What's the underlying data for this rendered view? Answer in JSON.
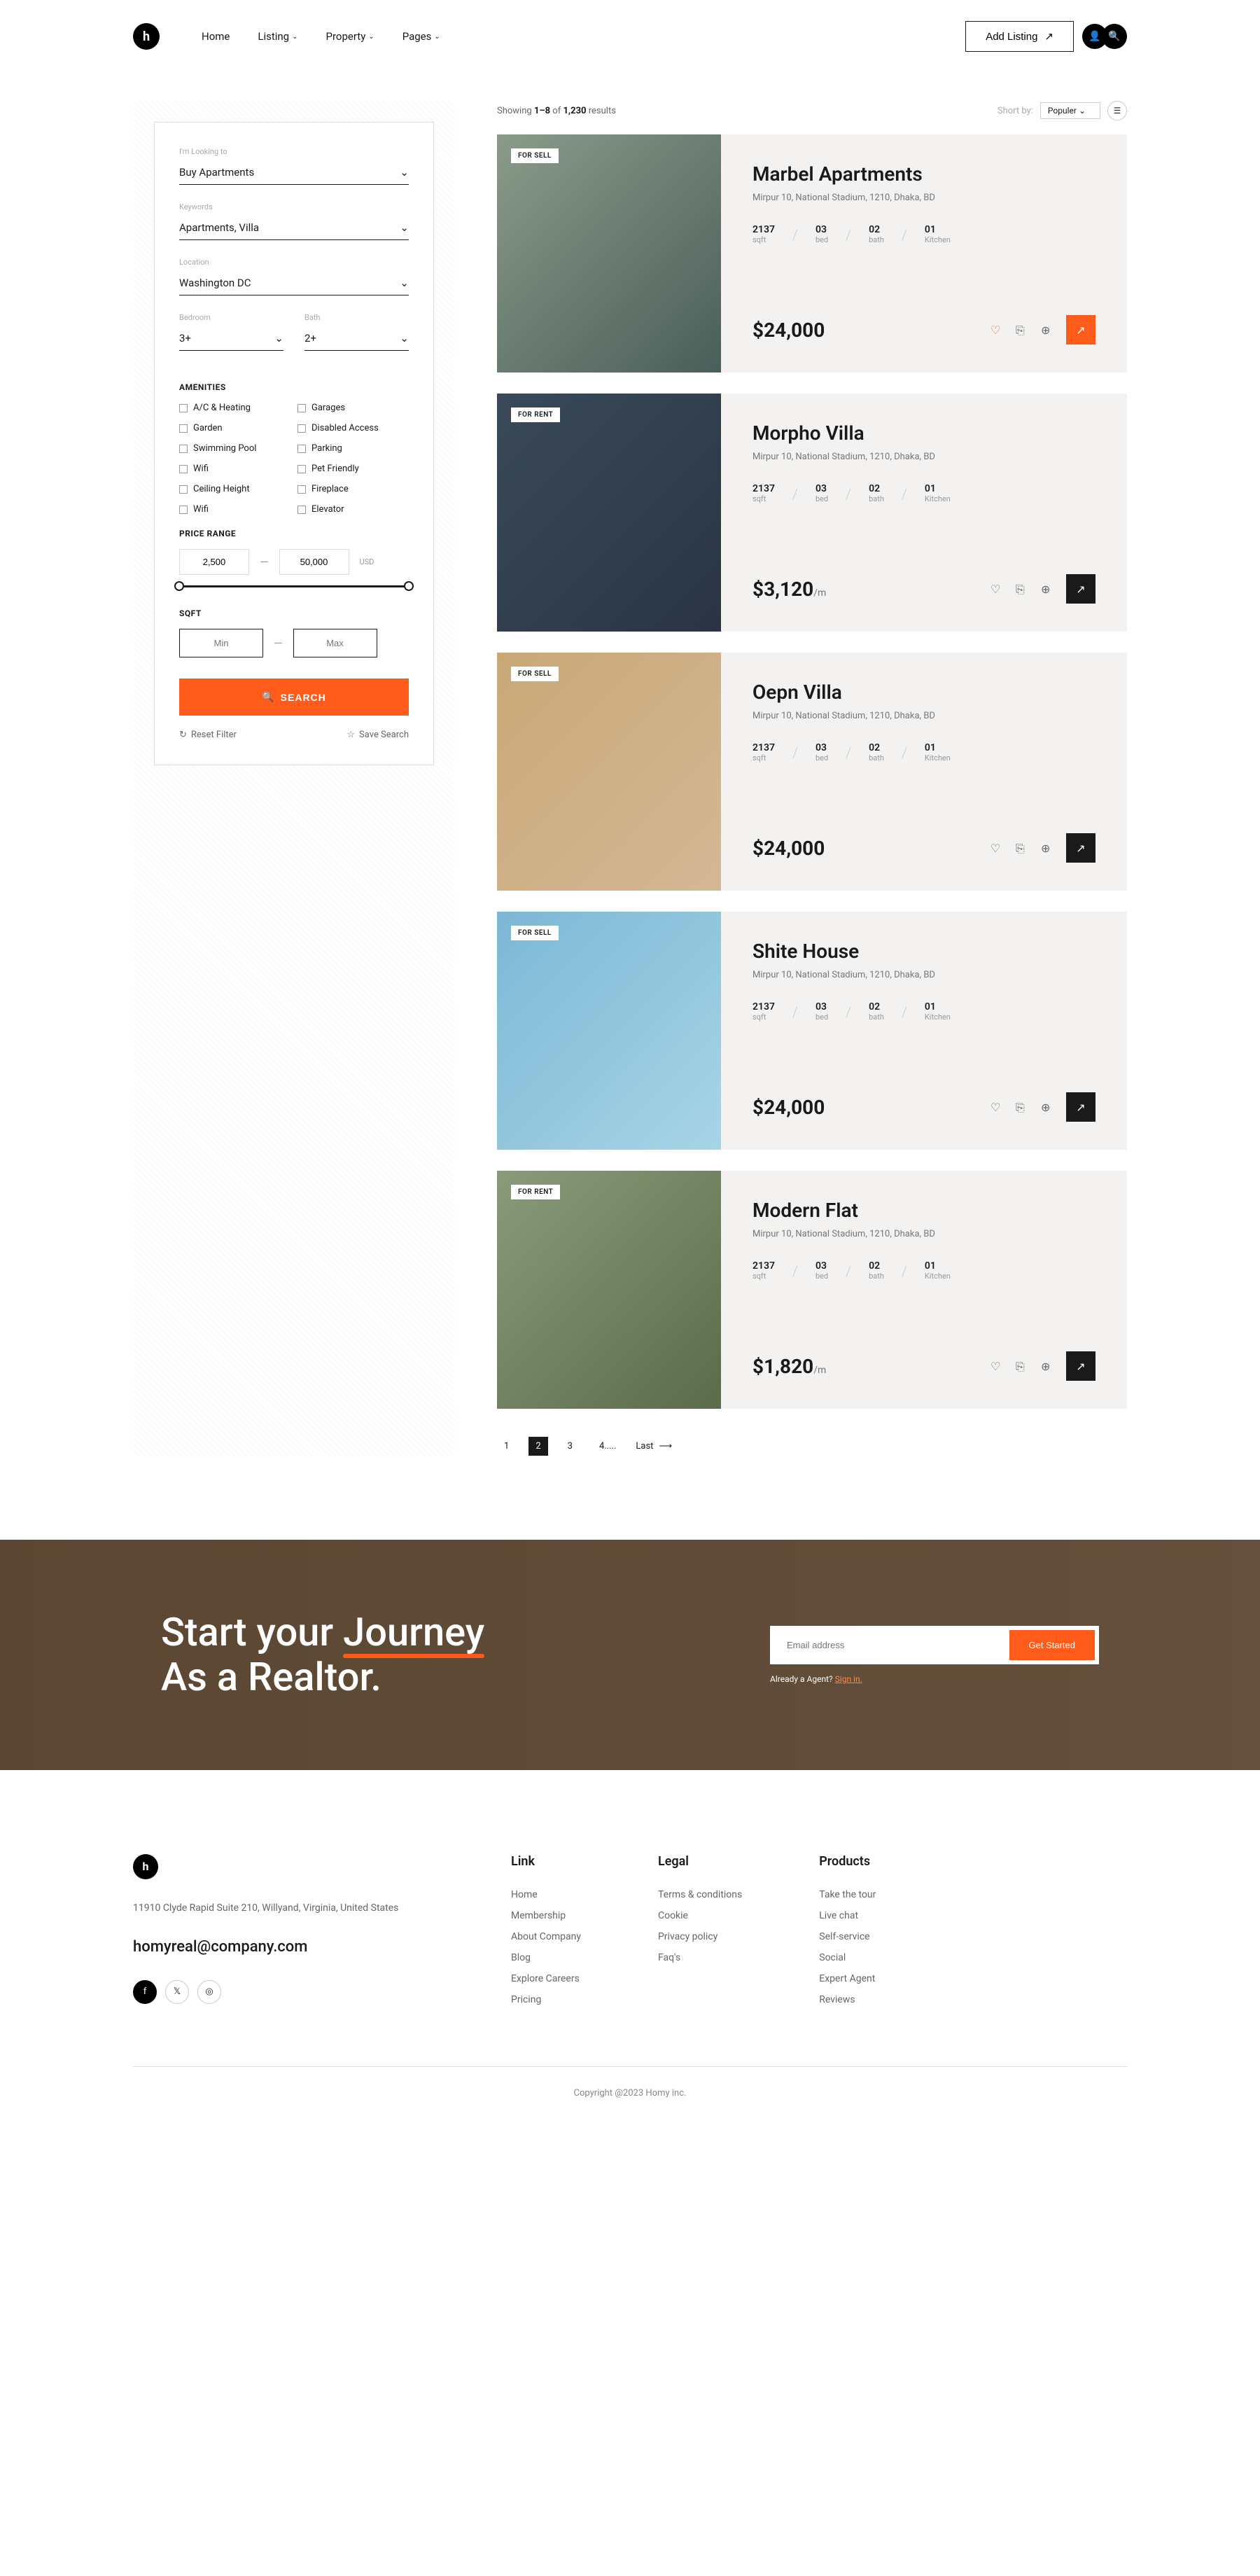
{
  "nav": {
    "home": "Home",
    "listing": "Listing",
    "property": "Property",
    "pages": "Pages",
    "addListing": "Add Listing"
  },
  "filter": {
    "lookingLabel": "I'm Looking to",
    "lookingValue": "Buy Apartments",
    "keywordsLabel": "Keywords",
    "keywordsValue": "Apartments, Villa",
    "locationLabel": "Location",
    "locationValue": "Washington DC",
    "bedroomLabel": "Bedroom",
    "bedroomValue": "3+",
    "bathLabel": "Bath",
    "bathValue": "2+",
    "amenitiesHeading": "AMENITIES",
    "amenities": [
      "A/C & Heating",
      "Garages",
      "Garden",
      "Disabled Access",
      "Swimming Pool",
      "Parking",
      "Wifi",
      "Pet Friendly",
      "Ceiling Height",
      "Fireplace",
      "Wifi",
      "Elevator"
    ],
    "priceHeading": "PRICE RANGE",
    "priceMin": "2,500",
    "priceMax": "50,000",
    "currency": "USD",
    "sqftHeading": "SQFT",
    "sqftMin": "Min",
    "sqftMax": "Max",
    "searchBtn": "SEARCH",
    "reset": "Reset Filter",
    "save": "Save Search"
  },
  "resultsHead": {
    "showing": "Showing",
    "range": "1–8",
    "of": "of",
    "total": "1,230",
    "results": "results",
    "sortLabel": "Short by:",
    "sortValue": "Populer"
  },
  "listings": [
    {
      "badge": "FOR SELL",
      "title": "Marbel Apartments",
      "loc": "Mirpur 10, National Stadium, 1210, Dhaka, BD",
      "sqft": "2137",
      "bed": "03",
      "bath": "02",
      "kitchen": "01",
      "price": "$24,000",
      "suffix": "",
      "imgClass": "",
      "arrowOrange": true,
      "liked": true
    },
    {
      "badge": "FOR RENT",
      "title": "Morpho Villa",
      "loc": "Mirpur 10, National Stadium, 1210, Dhaka, BD",
      "sqft": "2137",
      "bed": "03",
      "bath": "02",
      "kitchen": "01",
      "price": "$3,120",
      "suffix": "/m",
      "imgClass": "villa",
      "arrowOrange": false,
      "liked": false
    },
    {
      "badge": "FOR SELL",
      "title": "Oepn Villa",
      "loc": "Mirpur 10, National Stadium, 1210, Dhaka, BD",
      "sqft": "2137",
      "bed": "03",
      "bath": "02",
      "kitchen": "01",
      "price": "$24,000",
      "suffix": "",
      "imgClass": "oepn",
      "arrowOrange": false,
      "liked": false
    },
    {
      "badge": "FOR SELL",
      "title": "Shite House",
      "loc": "Mirpur 10, National Stadium, 1210, Dhaka, BD",
      "sqft": "2137",
      "bed": "03",
      "bath": "02",
      "kitchen": "01",
      "price": "$24,000",
      "suffix": "",
      "imgClass": "white",
      "arrowOrange": false,
      "liked": false
    },
    {
      "badge": "FOR RENT",
      "title": "Modern Flat",
      "loc": "Mirpur 10, National Stadium, 1210, Dhaka, BD",
      "sqft": "2137",
      "bed": "03",
      "bath": "02",
      "kitchen": "01",
      "price": "$1,820",
      "suffix": "/m",
      "imgClass": "modern",
      "arrowOrange": false,
      "liked": false
    }
  ],
  "specLabels": {
    "sqft": "sqft",
    "bed": "bed",
    "bath": "bath",
    "kitchen": "Kitchen"
  },
  "pagination": {
    "p1": "1",
    "p2": "2",
    "p3": "3",
    "p4": "4.....",
    "last": "Last"
  },
  "cta": {
    "line1": "Start your",
    "journey": "Journey",
    "line2": "As a Realtor.",
    "placeholder": "Email address",
    "btn": "Get Started",
    "sub": "Already a Agent?",
    "signin": "Sign in."
  },
  "footer": {
    "addr": "11910 Clyde Rapid Suite 210, Willyand, Virginia, United States",
    "email": "homyreal@company.com",
    "link": {
      "h": "Link",
      "items": [
        "Home",
        "Membership",
        "About Company",
        "Blog",
        "Explore Careers",
        "Pricing"
      ]
    },
    "legal": {
      "h": "Legal",
      "items": [
        "Terms & conditions",
        "Cookie",
        "Privacy policy",
        "Faq's"
      ]
    },
    "products": {
      "h": "Products",
      "items": [
        "Take the tour",
        "Live chat",
        "Self-service",
        "Social",
        "Expert Agent",
        "Reviews"
      ]
    },
    "copyright": "Copyright @2023 Homy inc."
  }
}
